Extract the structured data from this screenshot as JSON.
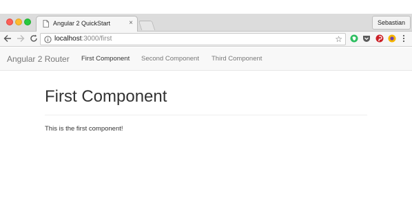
{
  "browser": {
    "tab": {
      "title": "Angular 2 QuickStart",
      "close_glyph": "×"
    },
    "profile_name": "Sebastian",
    "address": {
      "host": "localhost",
      "path": ":3000/first"
    },
    "star_glyph": "☆"
  },
  "navbar": {
    "brand": "Angular 2 Router",
    "links": [
      {
        "label": "First Component",
        "active": true
      },
      {
        "label": "Second Component",
        "active": false
      },
      {
        "label": "Third Component",
        "active": false
      }
    ]
  },
  "content": {
    "heading": "First Component",
    "text": "This is the first component!"
  },
  "icons": {
    "window_controls": [
      "close-dot",
      "minimize-dot",
      "maximize-dot"
    ],
    "toolbar": [
      "back-arrow-icon",
      "forward-arrow-icon",
      "reload-icon",
      "info-icon",
      "star-icon",
      "menu-icon"
    ],
    "extensions": [
      "evernote-icon",
      "pocket-icon",
      "pinterest-icon",
      "extension-icon"
    ]
  },
  "colors": {
    "close": "#fc5f57",
    "minimize": "#fdbc2e",
    "maximize": "#28c840",
    "evernote": "#2dbe60",
    "pocket": "#5b5b5b",
    "pinterest": "#cb2027",
    "extension": "#f5b400"
  }
}
